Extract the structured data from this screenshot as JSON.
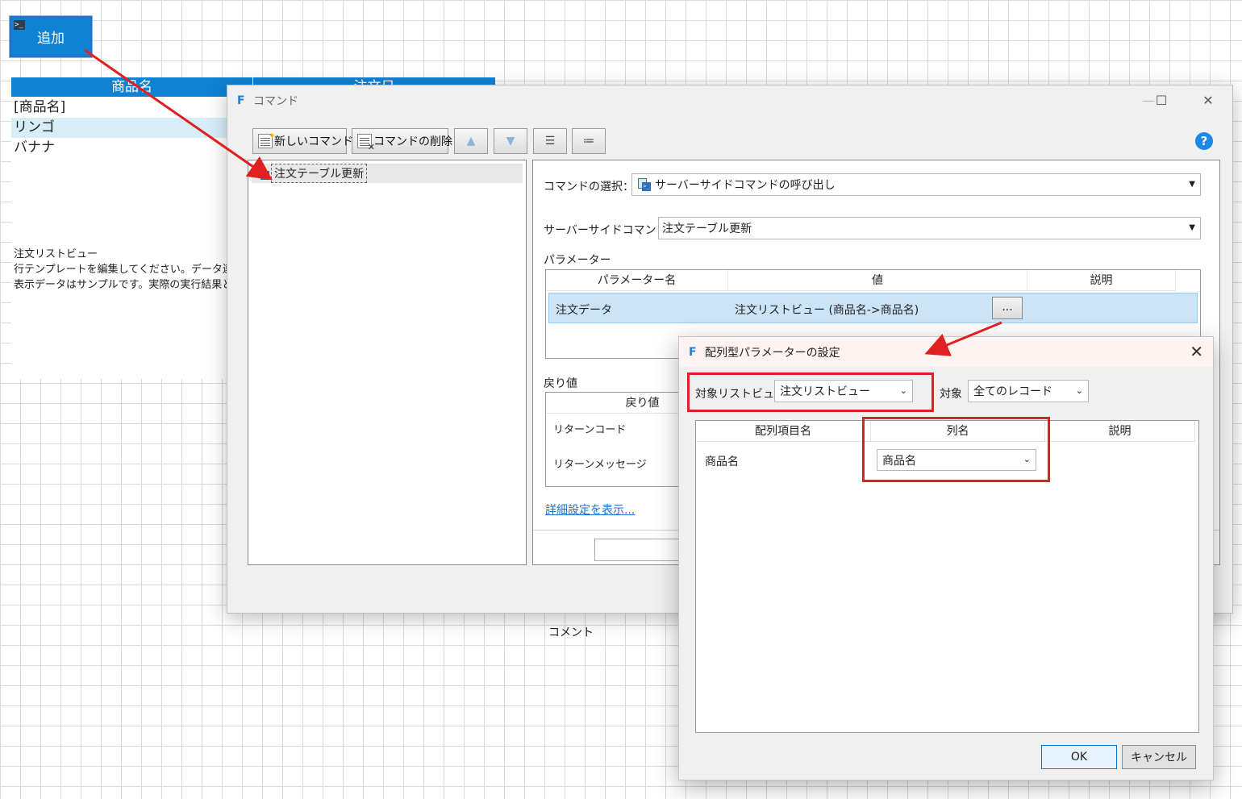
{
  "canvas": {
    "add_button_label": "追加",
    "table_headers": [
      "商品名",
      "注文日"
    ],
    "rows": [
      "[商品名]",
      "リンゴ",
      "バナナ"
    ],
    "listview_note": [
      "注文リストビュー",
      "行テンプレートを編集してください。データ連結",
      "表示データはサンプルです。実際の実行結果と"
    ]
  },
  "command_dialog": {
    "title": "コマンド",
    "toolbar": {
      "new_command": "新しいコマンド",
      "delete_command": "コマンドの削除"
    },
    "tree_item": "注文テーブル更新",
    "select_label": "コマンドの選択：",
    "select_value": "サーバーサイドコマンドの呼び出し",
    "server_command_label": "サーバーサイドコマンド：",
    "server_command_value": "注文テーブル更新",
    "params_label": "パラメーター",
    "params_headers": [
      "パラメーター名",
      "値",
      "説明"
    ],
    "param_row": {
      "name": "注文データ",
      "value": "注文リストビュー (商品名->商品名)",
      "button": "..."
    },
    "returns_label": "戻り値",
    "returns_header": "戻り値",
    "returns_rows": [
      "リターンコード",
      "リターンメッセージ"
    ],
    "details_link": "詳細設定を表示...",
    "comment_label": "コメント"
  },
  "array_dialog": {
    "title": "配列型パラメーターの設定",
    "target_listview_label": "対象リストビュー",
    "target_listview_value": "注文リストビュー",
    "target_label": "対象",
    "target_value": "全てのレコード",
    "grid_headers": [
      "配列項目名",
      "列名",
      "説明"
    ],
    "row_name": "商品名",
    "row_column_value": "商品名",
    "ok_label": "OK",
    "cancel_label": "キャンセル"
  },
  "colors": {
    "accent": "#0f82d4",
    "highlight": "#e02020",
    "selection": "#cce4f7"
  }
}
